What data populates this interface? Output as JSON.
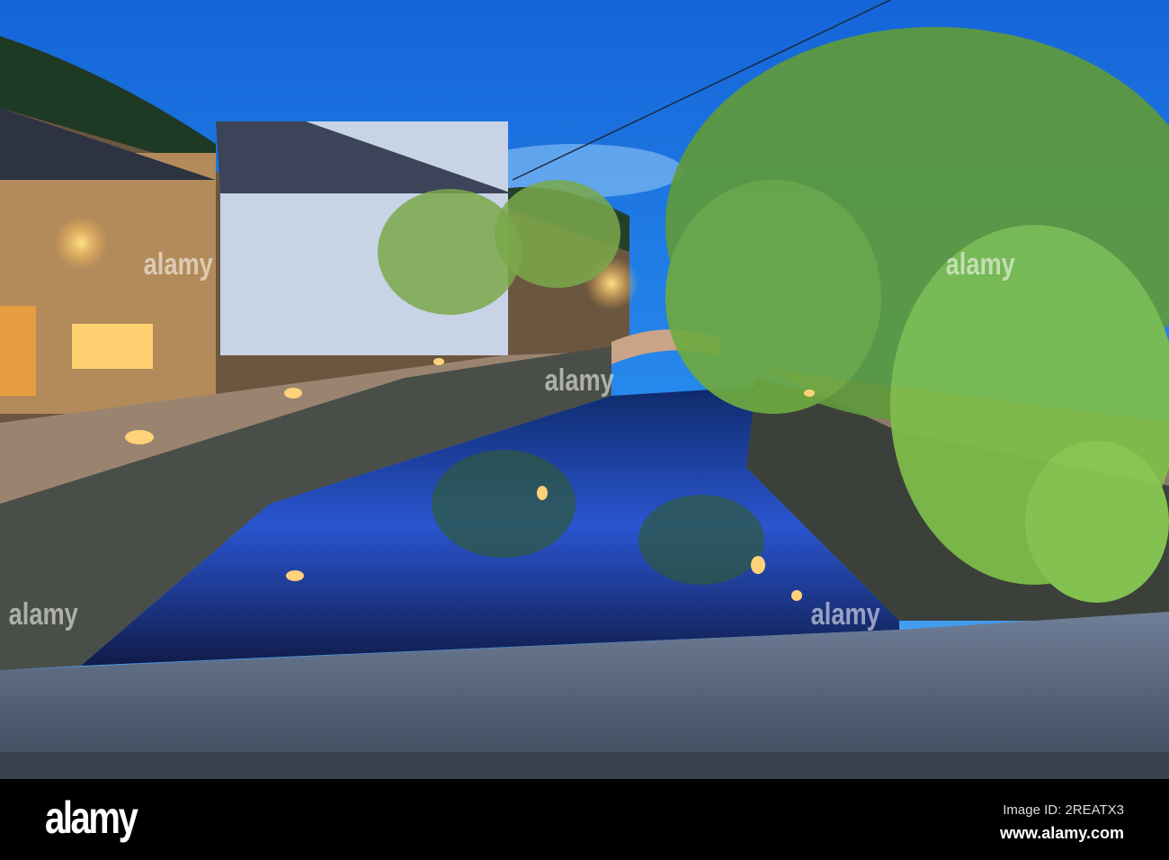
{
  "watermark": {
    "text": "alamy"
  },
  "footer": {
    "logo": "alamy",
    "image_id": "Image ID: 2REATX3",
    "site": "www.alamy.com"
  },
  "colors": {
    "sky": "#1e78e6",
    "water": "#1a3fa8",
    "lamp": "#ffb84a",
    "willow": "#7fbf4a"
  }
}
